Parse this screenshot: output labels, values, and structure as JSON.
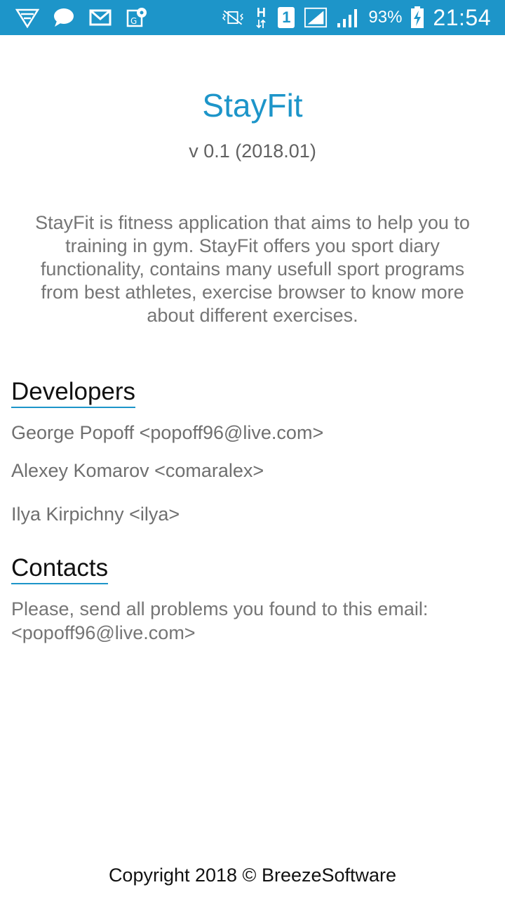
{
  "status_bar": {
    "left_icons": [
      "wifi-signal-icon",
      "chat-bubble-icon",
      "mail-icon",
      "map-pin-icon"
    ],
    "right_icons": [
      "vibrate-mute-icon",
      "h-network-icon",
      "sim-1-icon",
      "signal-bars-icon",
      "signal-bars-2-icon",
      "battery-charging-icon"
    ],
    "network_label": "H",
    "sim_label": "1",
    "battery": "93%",
    "time": "21:54"
  },
  "app": {
    "title": "StayFit",
    "version": "v 0.1 (2018.01)",
    "description": "StayFit is fitness application that aims to help you to training in gym. StayFit offers you sport diary functionality, contains many usefull sport programs from best athletes, exercise browser to know more about different exercises."
  },
  "developers": {
    "header": "Developers",
    "items": [
      "George Popoff <popoff96@live.com>",
      "Alexey Komarov <comaralex>",
      "Ilya Kirpichny <ilya>"
    ]
  },
  "contacts": {
    "header": "Contacts",
    "text": "Please, send all problems you found to this email: <popoff96@live.com>"
  },
  "footer": {
    "copyright": "Copyright 2018 © BreezeSoftware"
  },
  "colors": {
    "accent": "#1d95c9",
    "status_bar": "#1d95c9",
    "text_secondary": "#757575"
  }
}
